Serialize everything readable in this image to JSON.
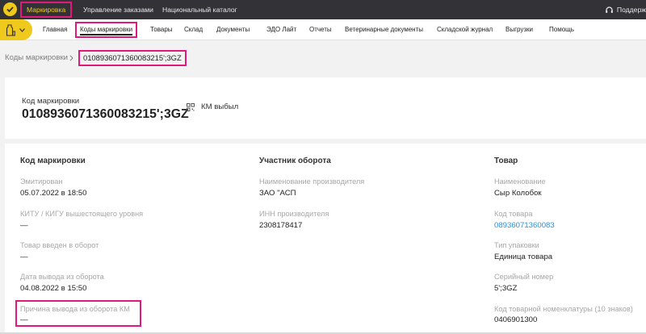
{
  "topbar": {
    "nav": [
      "Маркировка",
      "Управление заказами",
      "Национальный каталог"
    ],
    "support_label": "Поддерж"
  },
  "subnav": {
    "items": [
      "Главная",
      "Коды маркировки",
      "Товары",
      "Склад",
      "Документы",
      "ЭДО Лайт",
      "Отчеты",
      "Ветеринарные документы",
      "Складской журнал",
      "Выгрузки",
      "Помощь"
    ]
  },
  "breadcrumb": {
    "parent": "Коды маркировки",
    "current": "0108936071360083215';3GZ"
  },
  "header": {
    "label": "Код маркировки",
    "code": "0108936071360083215';3GZ",
    "status": "КМ выбыл"
  },
  "details": {
    "marking": {
      "title": "Код маркировки",
      "fields": [
        {
          "label": "Эмитирован",
          "value": "05.07.2022 в 18:50"
        },
        {
          "label": "КИТУ / КИГУ вышестоящего уровня",
          "value": "—"
        },
        {
          "label": "Товар введен в оборот",
          "value": "—"
        },
        {
          "label": "Дата вывода из оборота",
          "value": "04.08.2022 в 15:50"
        },
        {
          "label": "Причина вывода из оборота КМ",
          "value": "—"
        }
      ]
    },
    "participant": {
      "title": "Участник оборота",
      "fields": [
        {
          "label": "Наименование производителя",
          "value": "ЗАО \"АСП"
        },
        {
          "label": "ИНН производителя",
          "value": "2308178417"
        }
      ]
    },
    "product": {
      "title": "Товар",
      "fields": [
        {
          "label": "Наименование",
          "value": "Сыр Колобок"
        },
        {
          "label": "Код товара",
          "value": "08936071360083"
        },
        {
          "label": "Тип упаковки",
          "value": "Единица товара"
        },
        {
          "label": "Серийный номер",
          "value": "5';3GZ"
        },
        {
          "label": "Код товарной номенклатуры (10 знаков)",
          "value": "0406901300"
        }
      ]
    }
  },
  "colors": {
    "topbar": "#323237",
    "accent_yellow": "#f0c91d",
    "highlight": "#e0197a",
    "link": "#2f8fd6"
  }
}
